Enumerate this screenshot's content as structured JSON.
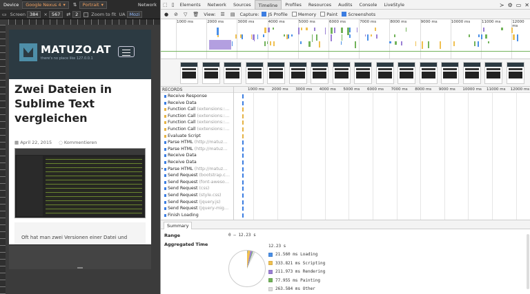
{
  "emulation": {
    "tabs": [
      {
        "label": "Device"
      },
      {
        "label": "Network"
      }
    ],
    "device_model": "Google Nexus 4",
    "orientation": "Portrait",
    "screen_label": "Screen",
    "screen_width": "384",
    "screen_height": "567",
    "dpr": "2",
    "zoom_label": "Zoom to fit",
    "ua_label": "UA",
    "ua_value": "Mozi"
  },
  "site": {
    "title": "MATUZO.AT",
    "tagline": "there's no place like 127.0.0.1",
    "post_title": "Zwei Dateien in Sublime Text vergleichen",
    "post_date": "April 22, 2015",
    "post_comments": "Kommentieren",
    "post_excerpt": "Oft hat man zwei Versionen einer Datei und möchte schnell herausfinden, ob es"
  },
  "devtools": {
    "tabs": [
      {
        "label": "Elements"
      },
      {
        "label": "Network"
      },
      {
        "label": "Sources"
      },
      {
        "label": "Timeline",
        "active": true
      },
      {
        "label": "Profiles"
      },
      {
        "label": "Resources"
      },
      {
        "label": "Audits"
      },
      {
        "label": "Console"
      },
      {
        "label": "LiveStyle"
      }
    ],
    "view_label": "View:",
    "capture_label": "Capture:",
    "capture_options": [
      {
        "label": "JS Profile",
        "checked": true
      },
      {
        "label": "Memory",
        "checked": false
      },
      {
        "label": "Paint",
        "checked": false
      },
      {
        "label": "Screenshots",
        "checked": true
      }
    ]
  },
  "overview_ticks": [
    "1000 ms",
    "2000 ms",
    "3000 ms",
    "4000 ms",
    "5000 ms",
    "6000 ms",
    "7000 ms",
    "8000 ms",
    "9000 ms",
    "10000 ms",
    "11000 ms",
    "12000 ms"
  ],
  "detail_ticks": [
    "1000 ms",
    "2000 ms",
    "3000 ms",
    "4000 ms",
    "5000 ms",
    "6000 ms",
    "7000 ms",
    "8000 ms",
    "9000 ms",
    "10000 ms",
    "11000 ms",
    "12000 ms"
  ],
  "records_header": "RECORDS",
  "records": [
    {
      "name": "Receive Response",
      "detail": "",
      "color": "#3b7de1"
    },
    {
      "name": "Receive Data",
      "detail": "",
      "color": "#3b7de1"
    },
    {
      "name": "Function Call",
      "detail": "(extensions::…",
      "color": "#e6b243"
    },
    {
      "name": "Function Call",
      "detail": "(extensions::…",
      "color": "#e6b243"
    },
    {
      "name": "Function Call",
      "detail": "(extensions::…",
      "color": "#e6b243"
    },
    {
      "name": "Function Call",
      "detail": "(extensions::…",
      "color": "#e6b243"
    },
    {
      "name": "Evaluate Script",
      "detail": "",
      "color": "#e6b243"
    },
    {
      "name": "Parse HTML",
      "detail": "(http://matuz…",
      "color": "#3b7de1"
    },
    {
      "name": "Parse HTML",
      "detail": "(http://matuz…",
      "color": "#3b7de1"
    },
    {
      "name": "Receive Data",
      "detail": "",
      "color": "#3b7de1"
    },
    {
      "name": "Receive Data",
      "detail": "",
      "color": "#3b7de1"
    },
    {
      "name": "Parse HTML",
      "detail": "(http://matuz…",
      "color": "#3b7de1"
    },
    {
      "name": "Send Request",
      "detail": "(bootstrap.c…",
      "color": "#3b7de1"
    },
    {
      "name": "Send Request",
      "detail": "(font-aweso…",
      "color": "#3b7de1"
    },
    {
      "name": "Send Request",
      "detail": "(css)",
      "color": "#3b7de1"
    },
    {
      "name": "Send Request",
      "detail": "(style.css)",
      "color": "#3b7de1"
    },
    {
      "name": "Send Request",
      "detail": "(jquery.js)",
      "color": "#3b7de1"
    },
    {
      "name": "Send Request",
      "detail": "(jquery-mig…",
      "color": "#3b7de1"
    },
    {
      "name": "Finish Loading",
      "detail": "",
      "color": "#3b7de1"
    }
  ],
  "summary": {
    "tab_label": "Summary",
    "range_label": "Range",
    "range_value": "0 – 12.23 s",
    "aggregated_label": "Aggregated Time",
    "total": "12.23 s",
    "items": [
      {
        "value_ms": 21.56,
        "label": "21.560 ms Loading",
        "color": "#4a8fe7"
      },
      {
        "value_ms": 333.821,
        "label": "333.821 ms Scripting",
        "color": "#f0c050"
      },
      {
        "value_ms": 211.973,
        "label": "211.973 ms Rendering",
        "color": "#9a7fd5"
      },
      {
        "value_ms": 77.955,
        "label": "77.955 ms Painting",
        "color": "#72b35a"
      },
      {
        "value_ms": 263.584,
        "label": "263.584 ms Other",
        "color": "#dddddd"
      }
    ]
  }
}
